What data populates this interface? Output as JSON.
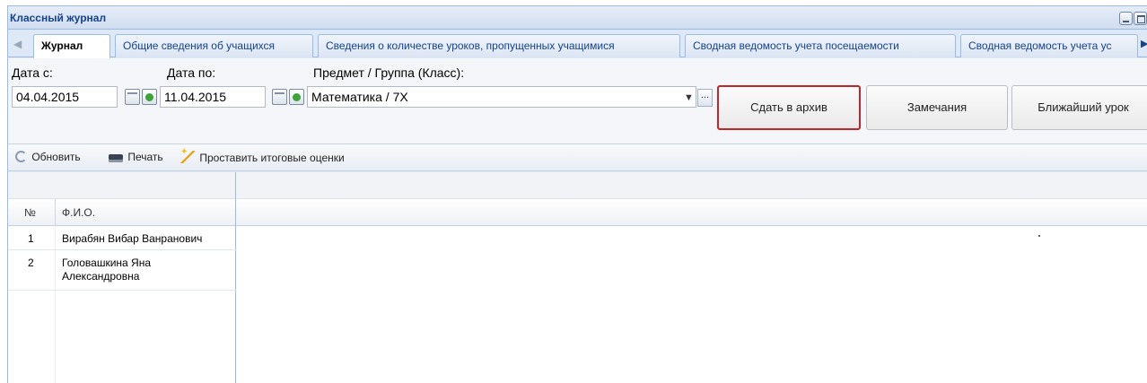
{
  "window": {
    "title": "Классный журнал"
  },
  "tabs": [
    {
      "label": "Журнал",
      "active": true
    },
    {
      "label": "Общие сведения об учащихся",
      "active": false
    },
    {
      "label": "Сведения о количестве уроков, пропущенных учащимися",
      "active": false
    },
    {
      "label": "Сводная ведомость учета посещаемости",
      "active": false
    },
    {
      "label": "Сводная ведомость учета ус",
      "active": false
    }
  ],
  "filters": {
    "date_from_label": "Дата с:",
    "date_from_value": "04.04.2015",
    "date_to_label": "Дата по:",
    "date_to_value": "11.04.2015",
    "subject_label": "Предмет / Группа (Класс):",
    "subject_value": "Математика / 7Х",
    "more_glyph": "..."
  },
  "buttons": {
    "archive": "Сдать в архив",
    "remarks": "Замечания",
    "nearest_lesson": "Ближайший урок"
  },
  "actions": {
    "refresh": "Обновить",
    "print": "Печать",
    "set_final_grades": "Проставить итоговые оценки"
  },
  "grid": {
    "columns": [
      "№",
      "Ф.И.О."
    ],
    "rows": [
      {
        "num": "1",
        "name": "Вирабян Вибар Ванранович"
      },
      {
        "num": "2",
        "name": "Головашкина Яна",
        "name2": "Александровна"
      }
    ]
  },
  "colors": {
    "highlight_border": "#c0262d",
    "panel_bg": "#dfe8f6",
    "border": "#99bbe8"
  }
}
